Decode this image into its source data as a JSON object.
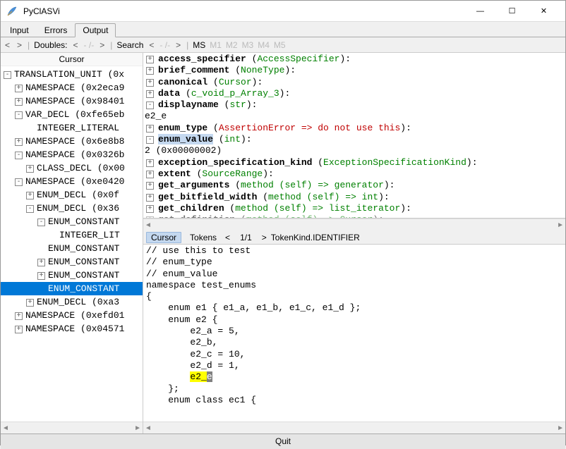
{
  "window": {
    "title": "PyClASVi",
    "min": "—",
    "max": "☐",
    "close": "✕"
  },
  "tabs": [
    "Input",
    "Errors",
    "Output"
  ],
  "active_tab": 2,
  "toolbar": {
    "arrows_left": "<",
    "arrows_right": ">",
    "doubles": "Doubles:",
    "doubles_pos": "- /- ",
    "search": "Search",
    "search_pos": "- /- ",
    "ms_active": "MS",
    "ms_inactive": [
      "M1",
      "M2",
      "M3",
      "M4",
      "M5"
    ]
  },
  "cursor_header": "Cursor",
  "tree": [
    {
      "depth": 0,
      "box": "-",
      "label": "TRANSLATION_UNIT (0x"
    },
    {
      "depth": 1,
      "box": "+",
      "label": "NAMESPACE (0x2eca9"
    },
    {
      "depth": 1,
      "box": "+",
      "label": "NAMESPACE (0x98401"
    },
    {
      "depth": 1,
      "box": "-",
      "label": "VAR_DECL (0xfe65eb"
    },
    {
      "depth": 2,
      "box": "",
      "label": "INTEGER_LITERAL"
    },
    {
      "depth": 1,
      "box": "+",
      "label": "NAMESPACE (0x6e8b8"
    },
    {
      "depth": 1,
      "box": "-",
      "label": "NAMESPACE (0x0326b"
    },
    {
      "depth": 2,
      "box": "+",
      "label": "CLASS_DECL (0x00"
    },
    {
      "depth": 1,
      "box": "-",
      "label": "NAMESPACE (0xe0420"
    },
    {
      "depth": 2,
      "box": "+",
      "label": "ENUM_DECL (0x0f"
    },
    {
      "depth": 2,
      "box": "-",
      "label": "ENUM_DECL (0x36"
    },
    {
      "depth": 3,
      "box": "-",
      "label": "ENUM_CONSTANT"
    },
    {
      "depth": 4,
      "box": "",
      "label": "INTEGER_LIT"
    },
    {
      "depth": 3,
      "box": "",
      "label": "ENUM_CONSTANT"
    },
    {
      "depth": 3,
      "box": "+",
      "label": "ENUM_CONSTANT"
    },
    {
      "depth": 3,
      "box": "+",
      "label": "ENUM_CONSTANT"
    },
    {
      "depth": 3,
      "box": "",
      "label": "ENUM_CONSTANT",
      "selected": true
    },
    {
      "depth": 2,
      "box": "+",
      "label": "ENUM_DECL (0xa3"
    },
    {
      "depth": 1,
      "box": "+",
      "label": "NAMESPACE (0xefd01"
    },
    {
      "depth": 1,
      "box": "+",
      "label": "NAMESPACE (0x04571"
    }
  ],
  "props": [
    {
      "box": "+",
      "name": "access_specifier",
      "type": "AccessSpecifier",
      "type_cls": "green",
      "suffix": ":"
    },
    {
      "box": "+",
      "name": "brief_comment",
      "type": "NoneType",
      "type_cls": "green",
      "suffix": ":"
    },
    {
      "box": "+",
      "name": "canonical",
      "type": "Cursor",
      "type_cls": "green",
      "suffix": ":"
    },
    {
      "box": "+",
      "name": "data",
      "type": "c_void_p_Array_3",
      "type_cls": "green",
      "suffix": ":"
    },
    {
      "box": "-",
      "name": "displayname",
      "type": "str",
      "type_cls": "green",
      "suffix": ":",
      "value_indent": "        e2_e"
    },
    {
      "box": "+",
      "name": "enum_type",
      "type": "AssertionError => do not use this",
      "type_cls": "red",
      "suffix": ":"
    },
    {
      "box": "-",
      "name": "enum_value",
      "name_hl": true,
      "type": "int",
      "type_cls": "green",
      "suffix": ":",
      "value_indent": "        2 (0x00000002)"
    },
    {
      "box": "+",
      "name": "exception_specification_kind",
      "type": "ExceptionSpecificationKind",
      "type_cls": "green",
      "suffix": ":"
    },
    {
      "box": "+",
      "name": "extent",
      "type": "SourceRange",
      "type_cls": "green",
      "suffix": ":"
    },
    {
      "box": "+",
      "name": "get_arguments",
      "type": "method (self) => generator",
      "type_cls": "green",
      "suffix": ":"
    },
    {
      "box": "+",
      "name": "get_bitfield_width",
      "type": "method (self) => int",
      "type_cls": "green",
      "suffix": ":"
    },
    {
      "box": "+",
      "name": "get_children",
      "type": "method (self) => list_iterator",
      "type_cls": "green",
      "suffix": ":"
    },
    {
      "box": "+",
      "name": "get_definition",
      "type": "method (self) => Cursor",
      "type_cls": "green",
      "suffix": ":",
      "faded": true
    }
  ],
  "srcbar": {
    "tab_cursor": "Cursor",
    "tab_tokens": "Tokens",
    "pos": "1/1",
    "kind": "TokenKind.IDENTIFIER"
  },
  "source_lines": [
    "// use this to test",
    "// enum_type",
    "// enum_value",
    "namespace test_enums",
    "{",
    "    enum e1 { e1_a, e1_b, e1_c, e1_d };",
    "    enum e2 {",
    "        e2_a = 5,",
    "        e2_b,",
    "        e2_c = 10,",
    "        e2_d = 1,",
    "        <MARK>e2_e</MARK>",
    "    };",
    "    enum class ec1 {"
  ],
  "footer": "Quit"
}
